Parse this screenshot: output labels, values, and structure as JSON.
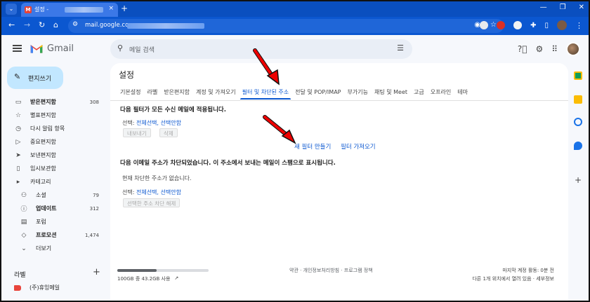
{
  "browser": {
    "tab_title": "설정 - ",
    "tab_close": "×",
    "new_tab": "+",
    "url": "mail.google.com",
    "window_controls": [
      "—",
      "❐",
      "✕"
    ]
  },
  "gmail": {
    "logo_text": "Gmail",
    "search_placeholder": "메일 검색",
    "compose_label": "편지쓰기",
    "nav": [
      {
        "label": "받은편지함",
        "count": "308",
        "icon": "inbox-icon",
        "glyph": "▭",
        "bold": true
      },
      {
        "label": "별표편지함",
        "count": "",
        "icon": "star-icon",
        "glyph": "☆"
      },
      {
        "label": "다시 알림 항목",
        "count": "",
        "icon": "clock-icon",
        "glyph": "◷"
      },
      {
        "label": "중요편지함",
        "count": "",
        "icon": "important-icon",
        "glyph": "▷"
      },
      {
        "label": "보낸편지함",
        "count": "",
        "icon": "send-icon",
        "glyph": "➤"
      },
      {
        "label": "임시보관함",
        "count": "",
        "icon": "draft-icon",
        "glyph": "▯"
      },
      {
        "label": "카테고리",
        "count": "",
        "icon": "label-icon",
        "glyph": "▸"
      },
      {
        "label": "소셜",
        "count": "79",
        "icon": "people-icon",
        "glyph": "⚇",
        "sub": true
      },
      {
        "label": "업데이트",
        "count": "312",
        "icon": "info-icon",
        "glyph": "ⓘ",
        "sub": true,
        "bold": true
      },
      {
        "label": "포럼",
        "count": "",
        "icon": "forum-icon",
        "glyph": "▤",
        "sub": true
      },
      {
        "label": "프로모션",
        "count": "1,474",
        "icon": "tag-icon",
        "glyph": "◇",
        "sub": true,
        "bold": true
      },
      {
        "label": "더보기",
        "count": "",
        "icon": "chevron-down-icon",
        "glyph": "⌄",
        "sub": true
      }
    ],
    "labels_heading": "라벨",
    "labels_add": "+",
    "label_item": "(주)휴잉메일"
  },
  "settings": {
    "title": "설정",
    "tabs": [
      "기본설정",
      "라벨",
      "받은편지함",
      "계정 및 가져오기",
      "필터 및 차단된 주소",
      "전달 및 POP/IMAP",
      "부가기능",
      "채팅 및 Meet",
      "고급",
      "오프라인",
      "테마"
    ],
    "active_tab_index": 4,
    "filters_heading": "다음 필터가 모든 수신 메일에 적용됩니다.",
    "select_prefix": "선택: ",
    "select_all": "전체선택",
    "select_sep": ", ",
    "select_none": "선택안함",
    "export_button": "내보내기",
    "delete_button": "삭제",
    "create_filter_link": "새 필터 만들기",
    "import_filter_link": "필터 가져오기",
    "blocked_heading": "다음 이메일 주소가 차단되었습니다. 이 주소에서 보내는 메일이 스팸으로 표시됩니다.",
    "no_blocked": "현재 차단한 주소가 없습니다.",
    "unblock_button": "선택한 주소 차단 해제"
  },
  "footer": {
    "storage_fraction": 0.43,
    "storage_text": "100GB 중 43.2GB 사용",
    "links": "약관 · 개인정보처리방침 · 프로그램 정책",
    "last_activity": "마지막 계정 활동: 0분 전",
    "other_location": "다른 1개 위치에서 열려 있음 · 세부정보"
  }
}
